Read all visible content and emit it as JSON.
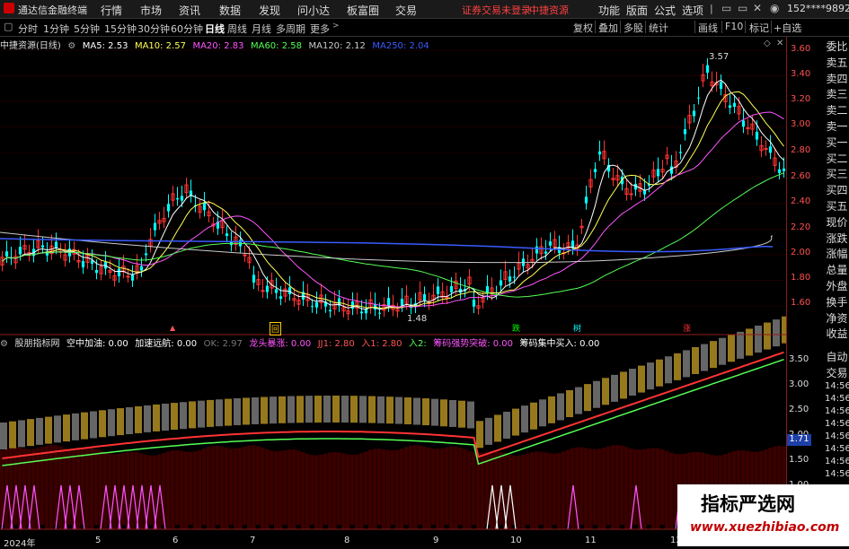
{
  "app": {
    "title": "通达信金融终端"
  },
  "menu": [
    "行情",
    "市场",
    "资讯",
    "数据",
    "发现",
    "问小达",
    "板富圈",
    "交易"
  ],
  "notice": {
    "login": "证券交易未登录",
    "source": "中捷资源"
  },
  "toolbar": [
    "功能",
    "版面",
    "公式",
    "选项"
  ],
  "user": {
    "phone": "152****9892"
  },
  "periods": [
    "分时",
    "1分钟",
    "5分钟",
    "15分钟",
    "30分钟",
    "60分钟",
    "日线",
    "周线",
    "月线",
    "多周期",
    "更多"
  ],
  "active_period": "日线",
  "right_buttons": [
    "复权",
    "叠加",
    "多股",
    "统计",
    "画线",
    "F10",
    "标记",
    "+自选"
  ],
  "main_chart": {
    "name": "中捷资源(日线)",
    "ma": [
      {
        "label": "MA5: 2.53",
        "color": "#ffffff"
      },
      {
        "label": "MA10: 2.57",
        "color": "#ffff55"
      },
      {
        "label": "MA20: 2.83",
        "color": "#ff55ff"
      },
      {
        "label": "MA60: 2.58",
        "color": "#55ff55"
      },
      {
        "label": "MA120: 2.12",
        "color": "#cccccc"
      },
      {
        "label": "MA250: 2.04",
        "color": "#3a5bff"
      }
    ],
    "high_label": "3.57",
    "low_label": "1.48",
    "yticks": [
      "3.60",
      "3.40",
      "3.20",
      "3.00",
      "2.80",
      "2.60",
      "2.40",
      "2.20",
      "2.00",
      "1.80",
      "1.60"
    ]
  },
  "event_markers": [
    {
      "text": "回",
      "color": "#ffcc00"
    },
    {
      "text": "跌",
      "color": "#00ff00"
    },
    {
      "text": "树",
      "color": "#00ffff"
    },
    {
      "text": "涨",
      "color": "#ff3333"
    }
  ],
  "sub_chart": {
    "name": "股朋指标网",
    "items": [
      {
        "label": "空中加油: 0.00",
        "color": "#ffffff"
      },
      {
        "label": "加速远航: 0.00",
        "color": "#ffffff"
      },
      {
        "label": "OK: 2.97",
        "color": "#777777"
      },
      {
        "label": "龙头暴涨: 0.00",
        "color": "#ff55ff"
      },
      {
        "label": "JJ1: 2.80",
        "color": "#ff5555"
      },
      {
        "label": "入1: 2.80",
        "color": "#ff5555"
      },
      {
        "label": "入2:",
        "color": "#55ff55"
      },
      {
        "label": "筹码强势突破: 0.00",
        "color": "#ff55ff"
      },
      {
        "label": "筹码集中买入: 0.00",
        "color": "#ffffff"
      }
    ],
    "yticks": [
      "3.50",
      "3.00",
      "2.50",
      "2.00",
      "1.50",
      "1.00"
    ],
    "right_values": [
      "14:56",
      "14:56",
      "14:56",
      "14:56",
      "14:56",
      "14:56",
      "14:56",
      "14:56"
    ],
    "current_value": "1.71"
  },
  "side_panel": [
    "委比",
    "卖五",
    "卖四",
    "卖三",
    "卖二",
    "卖一",
    "买一",
    "买二",
    "买三",
    "买四",
    "买五",
    "现价",
    "涨跌",
    "涨幅",
    "总量",
    "外盘",
    "换手",
    "净资",
    "收益",
    "自动",
    "交易"
  ],
  "date_axis": [
    "2024年",
    "5",
    "6",
    "7",
    "8",
    "9",
    "10",
    "11",
    "12"
  ],
  "watermark": {
    "title": "指标严选网",
    "url": "www.xuezhibiao.com"
  },
  "colors": {
    "up": "#ff3333",
    "down": "#00ffff",
    "bg": "#000000",
    "axis": "#8a1b1b"
  }
}
